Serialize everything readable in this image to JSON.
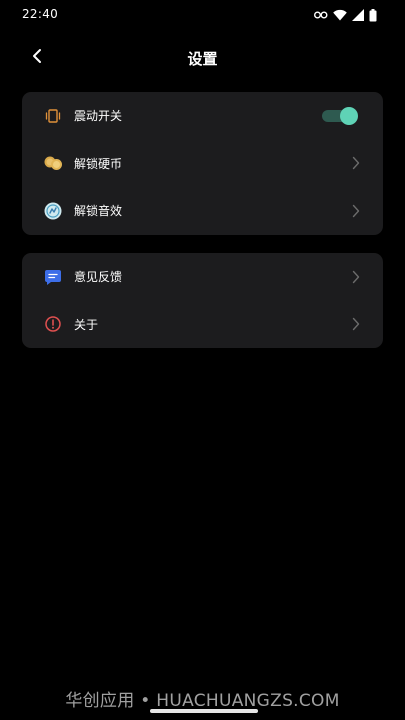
{
  "status_bar": {
    "time": "22:40",
    "icons": [
      "key-icon",
      "wifi-icon",
      "signal-icon",
      "battery-icon"
    ]
  },
  "header": {
    "title": "设置",
    "back_icon": "chevron-left-icon"
  },
  "settings_group_1": {
    "items": [
      {
        "label": "震动开关",
        "icon": "vibration-icon",
        "control": "toggle",
        "toggle_on": true
      },
      {
        "label": "解锁硬币",
        "icon": "coins-icon",
        "control": "chevron"
      },
      {
        "label": "解锁音效",
        "icon": "sound-effect-icon",
        "control": "chevron"
      }
    ]
  },
  "settings_group_2": {
    "items": [
      {
        "label": "意见反馈",
        "icon": "feedback-icon",
        "control": "chevron"
      },
      {
        "label": "关于",
        "icon": "about-icon",
        "control": "chevron"
      }
    ]
  },
  "watermark": {
    "text": "华创应用 • HUACHUANGZS.COM"
  },
  "colors": {
    "background": "#000000",
    "card": "#1c1c1e",
    "toggle_accent": "#5fd3b6",
    "toggle_track": "#2e5a50",
    "chevron": "#6b6b6b"
  }
}
